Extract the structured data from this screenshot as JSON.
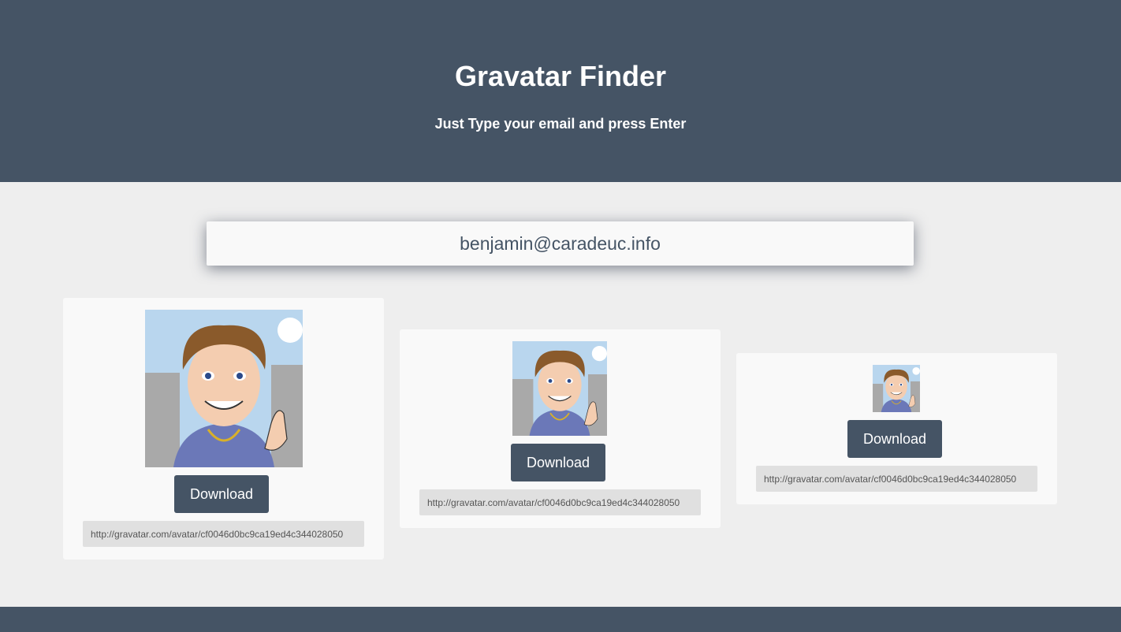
{
  "header": {
    "title": "Gravatar Finder",
    "subtitle": "Just Type your email and press Enter"
  },
  "search": {
    "value": "benjamin@caradeuc.info"
  },
  "results": [
    {
      "download_label": "Download",
      "url": "http://gravatar.com/avatar/cf0046d0bc9ca19ed4c344028050"
    },
    {
      "download_label": "Download",
      "url": "http://gravatar.com/avatar/cf0046d0bc9ca19ed4c344028050"
    },
    {
      "download_label": "Download",
      "url": "http://gravatar.com/avatar/cf0046d0bc9ca19ed4c344028050"
    }
  ],
  "colors": {
    "primary": "#455465",
    "background": "#eeeeee",
    "card": "#f9f9f9"
  }
}
